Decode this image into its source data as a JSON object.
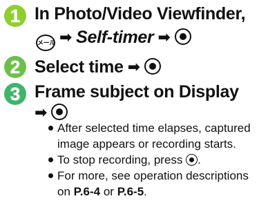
{
  "steps": [
    {
      "number": "1",
      "line1": "In Photo/Video Viewfinder,",
      "line2_italic": "Self-timer",
      "menu_key_label": "メール"
    },
    {
      "number": "2",
      "text": "Select time"
    },
    {
      "number": "3",
      "line1": "Frame subject on Display"
    }
  ],
  "bullets": [
    "After selected time elapses, captured image appears or recording starts.",
    "To stop recording, press",
    "For more, see operation descriptions on",
    "P.6-4",
    "or",
    "P.6-5",
    "."
  ],
  "colors": {
    "step1": "#8ecf2f",
    "step2": "#6cc04a",
    "step3": "#3fb56b"
  },
  "icons": [
    "menu-key-icon",
    "arrow-right-icon",
    "center-key-icon"
  ]
}
